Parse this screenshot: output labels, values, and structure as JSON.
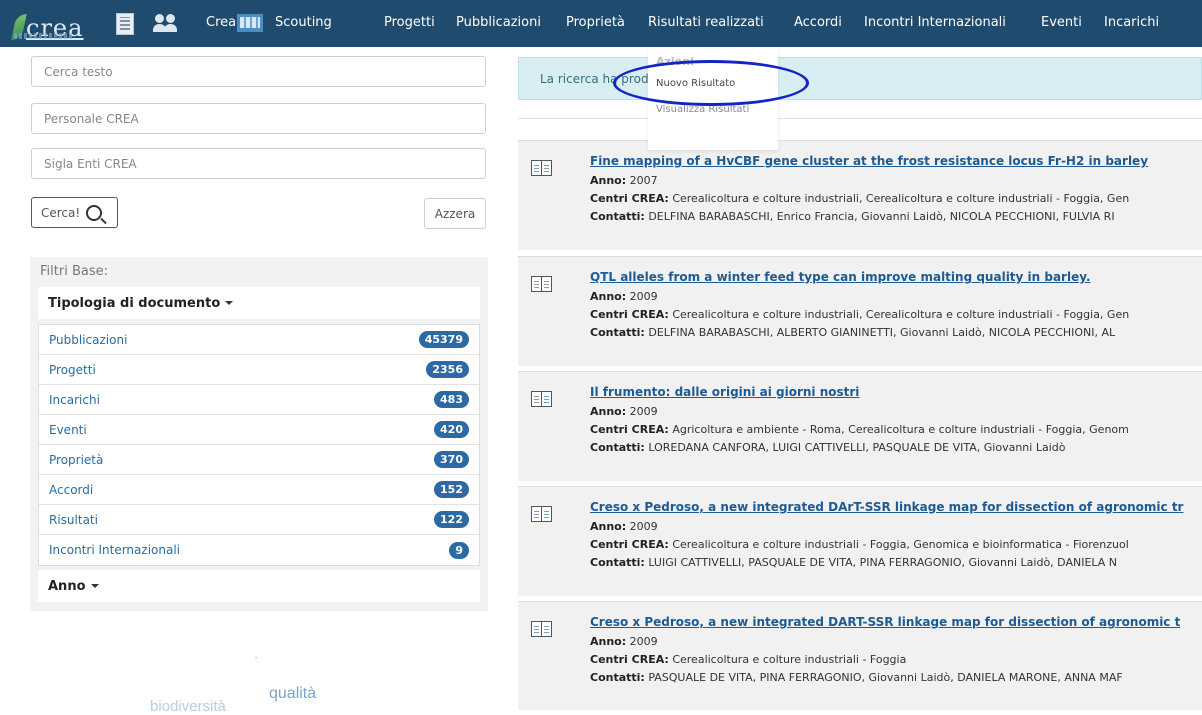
{
  "header": {
    "logo_text": "crea",
    "nav": [
      "Crea",
      "Scouting",
      "Progetti",
      "Pubblicazioni",
      "Proprietà",
      "Risultati realizzati",
      "Accordi",
      "Incontri Internazionali",
      "Eventi",
      "Incarichi"
    ],
    "icons": [
      "building-icon",
      "people-icon",
      "books-icon"
    ]
  },
  "dropdown": {
    "header": "Azioni",
    "items": [
      "Nuovo Risultato",
      "Visualizza Risultati"
    ]
  },
  "search": {
    "text_placeholder": "Cerca testo",
    "personale_placeholder": "Personale CREA",
    "sigla_placeholder": "Sigla Enti CREA",
    "search_label": "Cerca!",
    "reset_label": "Azzera"
  },
  "filters": {
    "title": "Filtri Base:",
    "doc_type_label": "Tipologia di documento",
    "items": [
      {
        "label": "Pubblicazioni",
        "count": "45379"
      },
      {
        "label": "Progetti",
        "count": "2356"
      },
      {
        "label": "Incarichi",
        "count": "483"
      },
      {
        "label": "Eventi",
        "count": "420"
      },
      {
        "label": "Proprietà",
        "count": "370"
      },
      {
        "label": "Accordi",
        "count": "152"
      },
      {
        "label": "Risultati",
        "count": "122"
      },
      {
        "label": "Incontri Internazionali",
        "count": "9"
      }
    ],
    "year_label": "Anno"
  },
  "decor_words": [
    "qualità",
    "biodiversità"
  ],
  "alert": {
    "text": "La ricerca ha prod"
  },
  "labels": {
    "anno": "Anno:",
    "centri": "Centri CREA:",
    "contatti": "Contatti:"
  },
  "results": [
    {
      "title": "Fine mapping of a HvCBF gene cluster at the frost resistance locus Fr-H2 in barley",
      "year": "2007",
      "centri": "Cerealicoltura e colture industriali, Cerealicoltura e colture industriali - Foggia, Gen",
      "contatti": "DELFINA BARABASCHI, Enrico Francia, Giovanni Laidò, NICOLA PECCHIONI, FULVIA RI"
    },
    {
      "title": "QTL alleles from a winter feed type can improve malting quality in barley.",
      "year": "2009",
      "centri": "Cerealicoltura e colture industriali, Cerealicoltura e colture industriali - Foggia, Gen",
      "contatti": "DELFINA BARABASCHI, ALBERTO GIANINETTI, Giovanni Laidò, NICOLA PECCHIONI, AL"
    },
    {
      "title": "Il frumento: dalle origini ai giorni nostri",
      "year": "2009",
      "centri": "Agricoltura e ambiente - Roma, Cerealicoltura e colture industriali - Foggia, Genom",
      "contatti": "LOREDANA CANFORA, LUIGI CATTIVELLI, PASQUALE DE VITA, Giovanni Laidò"
    },
    {
      "title": "Creso x Pedroso, a new integrated DArT-SSR linkage map for dissection of agronomic tr",
      "year": "2009",
      "centri": "Cerealicoltura e colture industriali - Foggia, Genomica e bioinformatica - Fiorenzuol",
      "contatti": "LUIGI CATTIVELLI, PASQUALE DE VITA, PINA FERRAGONIO, Giovanni Laidò, DANIELA N"
    },
    {
      "title": "Creso x Pedroso, a new integrated DART-SSR linkage map for dissection of agronomic t",
      "year": "2009",
      "centri": "Cerealicoltura e colture industriali - Foggia",
      "contatti": "PASQUALE DE VITA, PINA FERRAGONIO, Giovanni Laidò, DANIELA MARONE, ANNA MAF"
    }
  ]
}
